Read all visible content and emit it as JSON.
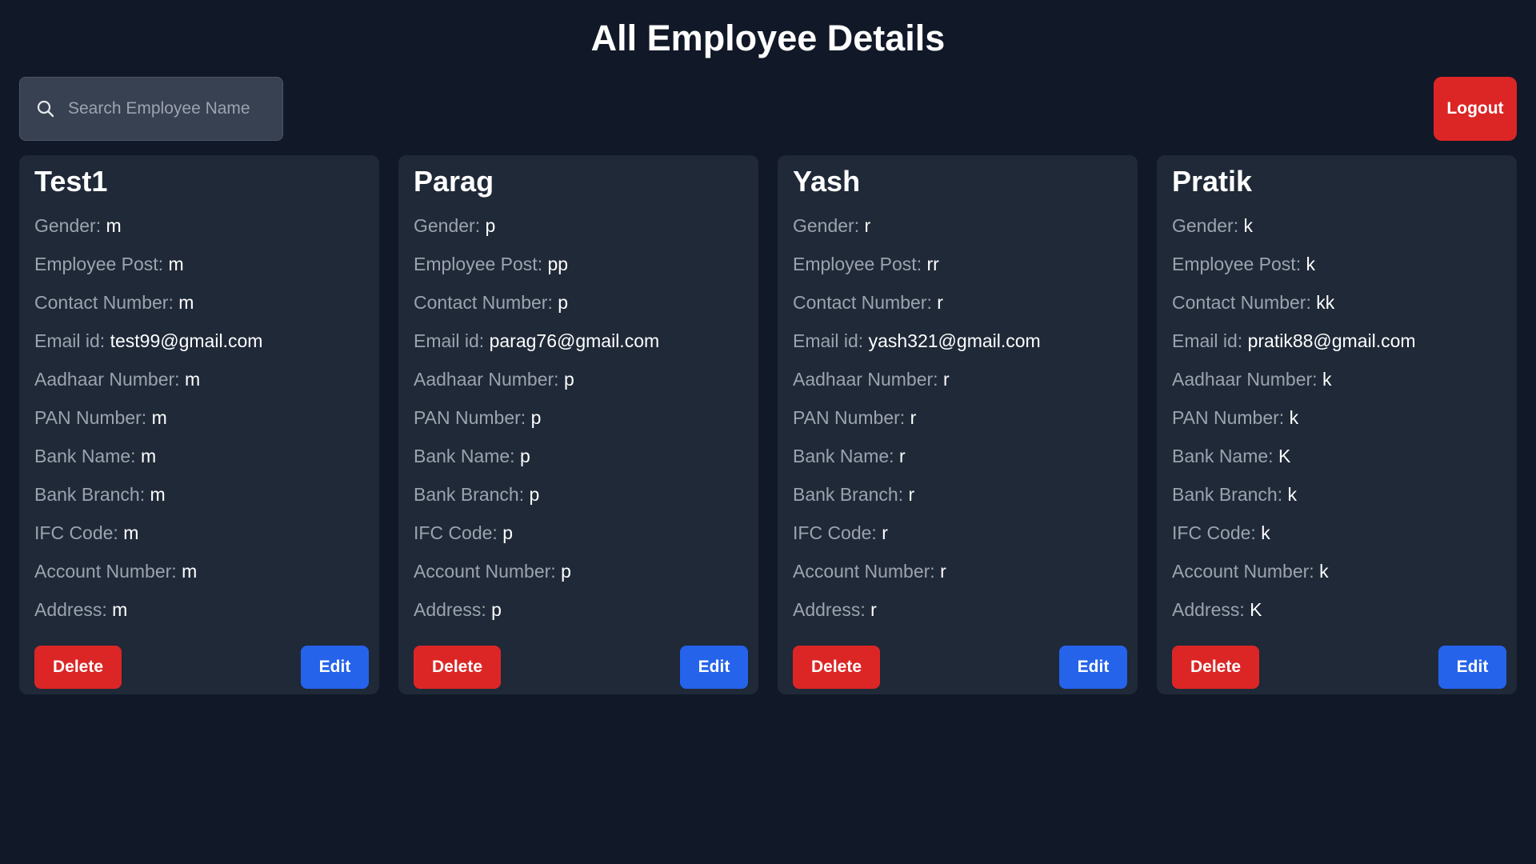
{
  "page": {
    "title": "All Employee Details"
  },
  "search": {
    "placeholder": "Search Employee Name",
    "value": ""
  },
  "header": {
    "logout_label": "Logout"
  },
  "colors": {
    "background": "#111827",
    "card": "#1f2937",
    "danger": "#dc2626",
    "primary": "#2563eb"
  },
  "labels": {
    "gender": "Gender:",
    "post": "Employee Post:",
    "contact": "Contact Number:",
    "email": "Email id:",
    "aadhaar": "Aadhaar Number:",
    "pan": "PAN Number:",
    "bank_name": "Bank Name:",
    "bank_branch": "Bank Branch:",
    "ifc": "IFC Code:",
    "account": "Account Number:",
    "address": "Address:",
    "delete": "Delete",
    "edit": "Edit"
  },
  "employees": [
    {
      "name": "Test1",
      "gender": "m",
      "post": "m",
      "contact": "m",
      "email": "test99@gmail.com",
      "aadhaar": "m",
      "pan": "m",
      "bank_name": "m",
      "bank_branch": "m",
      "ifc": "m",
      "account": "m",
      "address": "m"
    },
    {
      "name": "Parag",
      "gender": "p",
      "post": "pp",
      "contact": "p",
      "email": "parag76@gmail.com",
      "aadhaar": "p",
      "pan": "p",
      "bank_name": "p",
      "bank_branch": "p",
      "ifc": "p",
      "account": "p",
      "address": "p"
    },
    {
      "name": "Yash",
      "gender": "r",
      "post": "rr",
      "contact": "r",
      "email": "yash321@gmail.com",
      "aadhaar": "r",
      "pan": "r",
      "bank_name": "r",
      "bank_branch": "r",
      "ifc": "r",
      "account": "r",
      "address": "r"
    },
    {
      "name": "Pratik",
      "gender": "k",
      "post": "k",
      "contact": "kk",
      "email": "pratik88@gmail.com",
      "aadhaar": "k",
      "pan": "k",
      "bank_name": "K",
      "bank_branch": "k",
      "ifc": "k",
      "account": "k",
      "address": "K"
    }
  ]
}
